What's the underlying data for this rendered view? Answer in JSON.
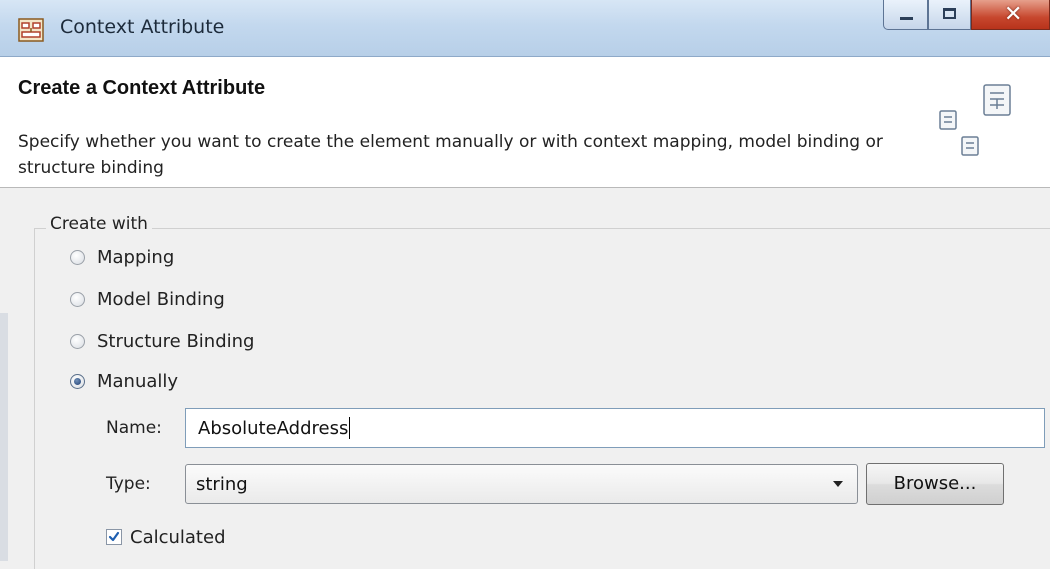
{
  "window": {
    "title": "Context Attribute",
    "icon": "context-attribute-icon",
    "controls": [
      "minimize-icon",
      "maximize-icon",
      "close-icon"
    ]
  },
  "header": {
    "title": "Create a Context Attribute",
    "description": "Specify whether you want to create the element manually or with context mapping, model binding or structure binding",
    "graphic": "documents-icon"
  },
  "create_with": {
    "group_label": "Create with",
    "options": [
      {
        "label": "Mapping",
        "checked": false
      },
      {
        "label": "Model Binding",
        "checked": false
      },
      {
        "label": "Structure Binding",
        "checked": false
      },
      {
        "label": "Manually",
        "checked": true
      }
    ]
  },
  "form": {
    "name_label": "Name:",
    "name_value": "AbsoluteAddress",
    "type_label": "Type:",
    "type_value": "string",
    "browse_label": "Browse...",
    "calculated_label": "Calculated",
    "calculated_checked": true
  },
  "colors": {
    "titlebar": "#c3d8ee",
    "close_button": "#c7472e",
    "radio_selected": "#1f3f73",
    "checkmark": "#1f5fb0"
  }
}
